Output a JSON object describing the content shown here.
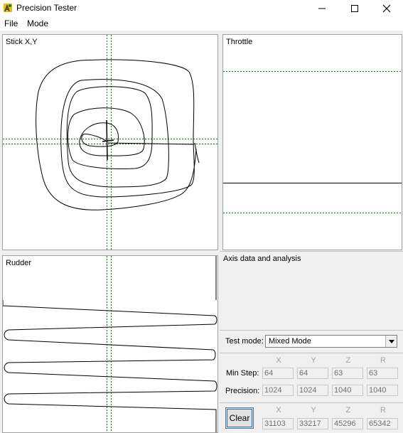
{
  "window": {
    "title": "Precision Tester"
  },
  "menu": {
    "file": "File",
    "mode": "Mode"
  },
  "panels": {
    "stick": "Stick X,Y",
    "throttle": "Throttle",
    "rudder": "Rudder",
    "analysis": "Axis data and analysis"
  },
  "test_mode": {
    "label": "Test mode:",
    "selected": "Mixed Mode"
  },
  "columns": [
    "X",
    "Y",
    "Z",
    "R"
  ],
  "min_step": {
    "label": "Min Step:",
    "values": [
      "64",
      "64",
      "63",
      "63"
    ]
  },
  "precision": {
    "label": "Precision:",
    "values": [
      "1024",
      "1024",
      "1040",
      "1040"
    ]
  },
  "raw": {
    "values": [
      "31103",
      "33217",
      "45296",
      "65342"
    ]
  },
  "clear_label": "Clear",
  "colors": {
    "guide": "#008000",
    "trace": "#000000",
    "panel_border": "#a0a0a0"
  }
}
